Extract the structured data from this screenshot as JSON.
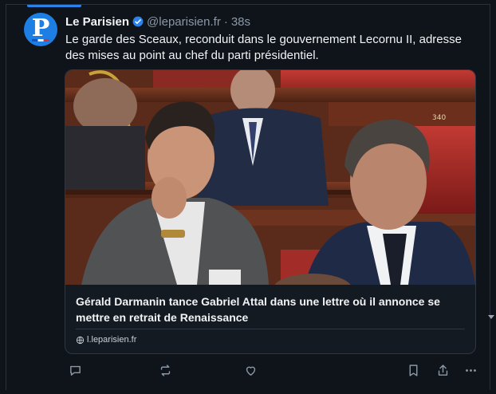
{
  "post": {
    "author": {
      "display_name": "Le Parisien",
      "handle": "@leparisien.fr",
      "avatar_letter": "P",
      "verified": true
    },
    "separator": "·",
    "time": "38s",
    "text": "Le garde des Sceaux, reconduit dans le gouvernement Lecornu II, adresse des mises au point au chef du parti présidentiel.",
    "link_card": {
      "title": "Gérald Darmanin tance Gabriel Attal dans une lettre où il annonce se mettre en retrait de Renaissance",
      "domain": "l.leparisien.fr",
      "image_seat_number": "340"
    },
    "actions": [
      {
        "name": "reply-icon",
        "label": "Reply"
      },
      {
        "name": "repost-icon",
        "label": "Repost"
      },
      {
        "name": "like-icon",
        "label": "Like"
      },
      {
        "name": "bookmark-icon",
        "label": "Bookmark"
      },
      {
        "name": "share-icon",
        "label": "Share"
      },
      {
        "name": "more-icon",
        "label": "More"
      }
    ]
  },
  "colors": {
    "background": "#0f141b",
    "accent": "#2b83ea",
    "muted_text": "#8b98a5",
    "avatar_bg": "#1d7fe4"
  }
}
